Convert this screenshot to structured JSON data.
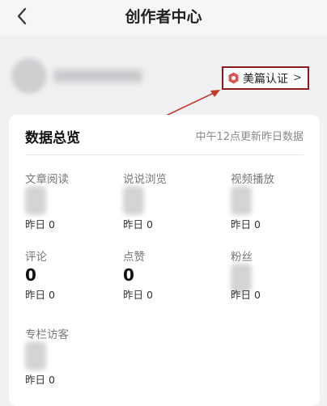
{
  "header": {
    "title": "创作者中心",
    "back_icon": "chevron-left-icon"
  },
  "profile": {
    "cert_label": "美篇认证",
    "cert_arrow": ">",
    "cert_icon": "badge-icon",
    "cert_icon_color": "#d9534f",
    "highlight_color": "#8e1a1a"
  },
  "overview": {
    "title": "数据总览",
    "update_note": "中午12点更新昨日数据",
    "stats": [
      {
        "label": "文章阅读",
        "value": "",
        "sub": "昨日 0"
      },
      {
        "label": "说说浏览",
        "value": "",
        "sub": "昨日 0"
      },
      {
        "label": "视频播放",
        "value": "",
        "sub": "昨日 0"
      },
      {
        "label": "评论",
        "value": "0",
        "sub": "昨日 0"
      },
      {
        "label": "点赞",
        "value": "0",
        "sub": "昨日 0"
      },
      {
        "label": "粉丝",
        "value": "",
        "sub": "昨日 0"
      },
      {
        "label": "专栏访客",
        "value": "",
        "sub": "昨日 0"
      }
    ]
  }
}
